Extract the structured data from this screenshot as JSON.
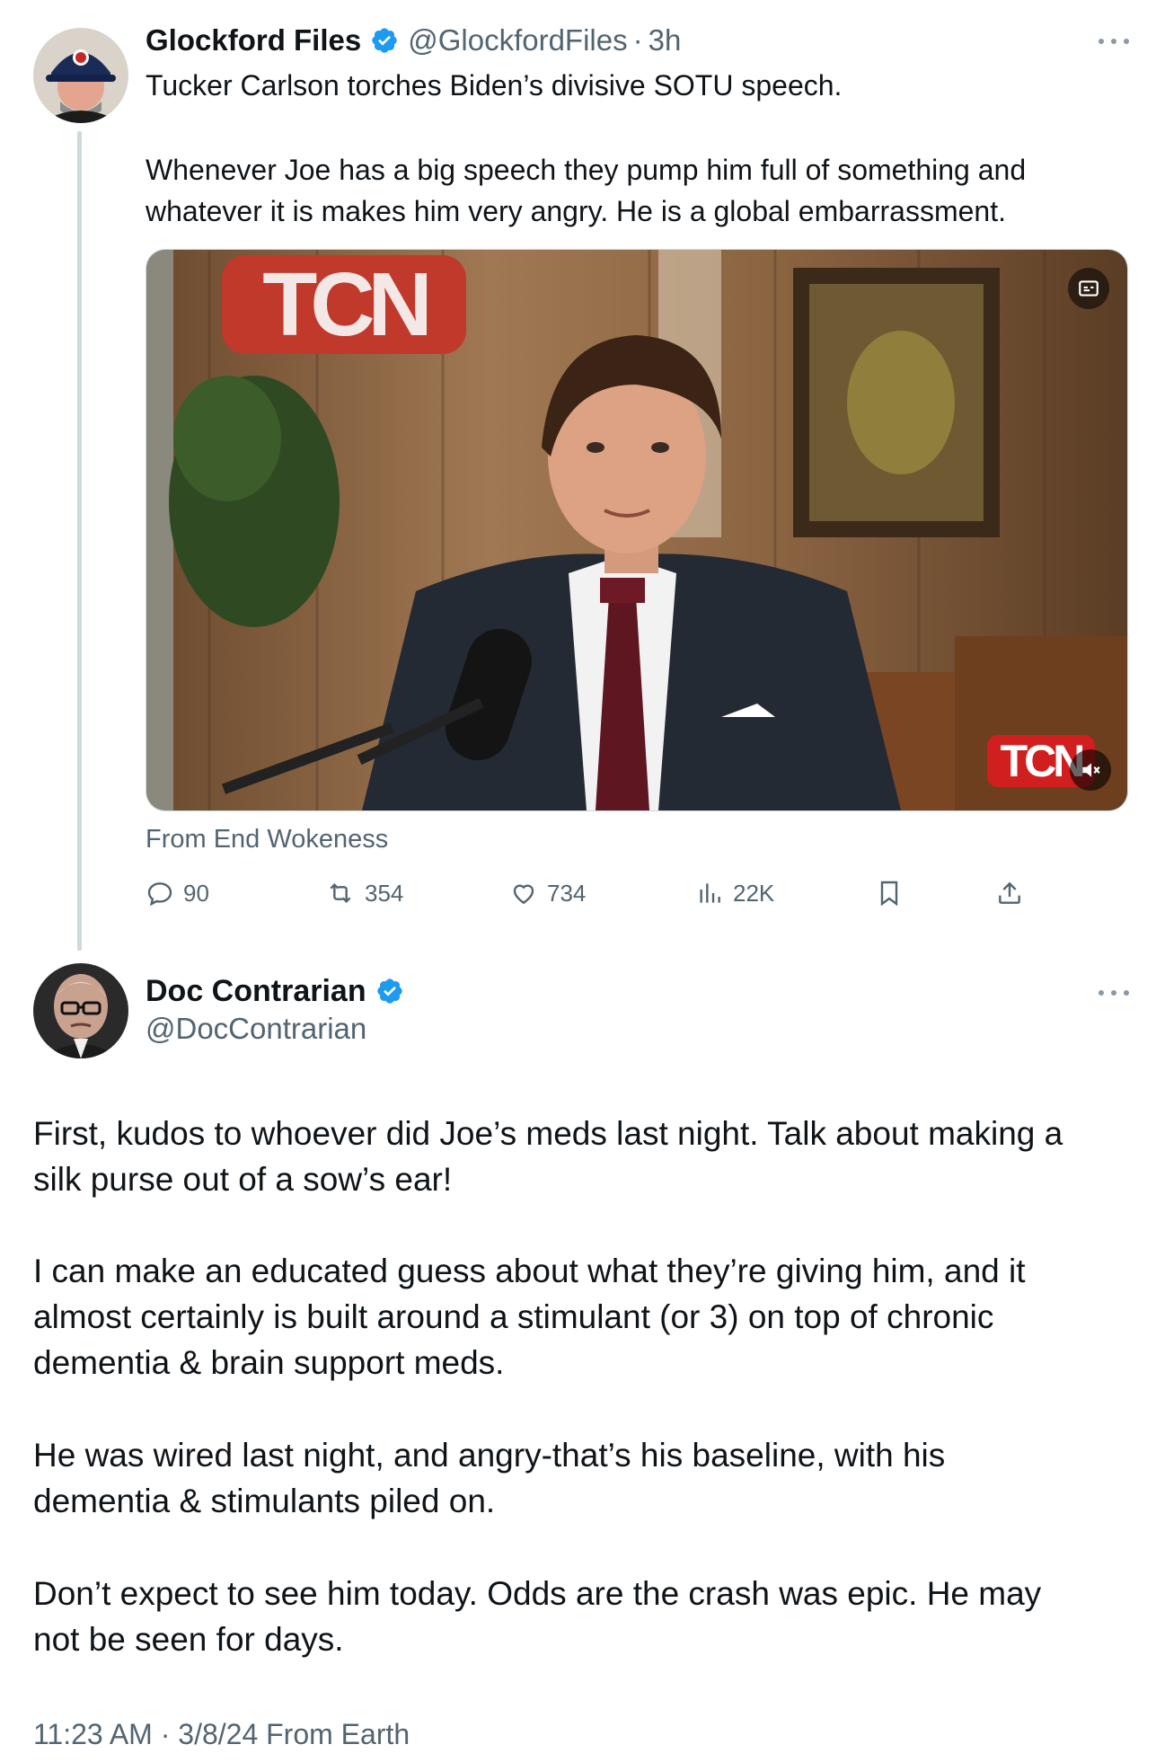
{
  "tweet1": {
    "display_name": "Glockford Files",
    "handle": "@GlockfordFiles",
    "separator": "·",
    "time": "3h",
    "text_line1": "Tucker Carlson torches Biden’s divisive SOTU speech.",
    "text_line2": "Whenever Joe has a big speech they pump him full of something and",
    "text_line3": "whatever it is makes him very angry. He is a global embarrassment.",
    "media": {
      "logo_text": "TCN",
      "watermark_text": "TCN"
    },
    "from_label": "From End Wokeness",
    "actions": {
      "replies": "90",
      "reposts": "354",
      "likes": "734",
      "views": "22K"
    }
  },
  "tweet2": {
    "display_name": "Doc Contrarian",
    "handle": "@DocContrarian",
    "paragraphs": [
      [
        "First, kudos to whoever did Joe’s meds last night. Talk about making a",
        "silk purse out of a sow’s ear!"
      ],
      [
        "I can make an educated guess about what they’re giving him, and it",
        "almost certainly is built around a stimulant (or 3) on top of chronic",
        "dementia & brain support meds."
      ],
      [
        "He was wired last night, and angry-that’s his baseline, with his",
        "dementia & stimulants piled on."
      ],
      [
        "Don’t expect to see him today. Odds are the crash was epic. He may",
        "not be seen for days."
      ]
    ],
    "timestamp": "11:23 AM · 3/8/24 From Earth"
  },
  "colors": {
    "text_primary": "#0f1419",
    "text_secondary": "#536471",
    "verified_blue": "#1d9bf0",
    "thread_line": "#cfd9de",
    "tcn_red": "#d11e1e"
  }
}
